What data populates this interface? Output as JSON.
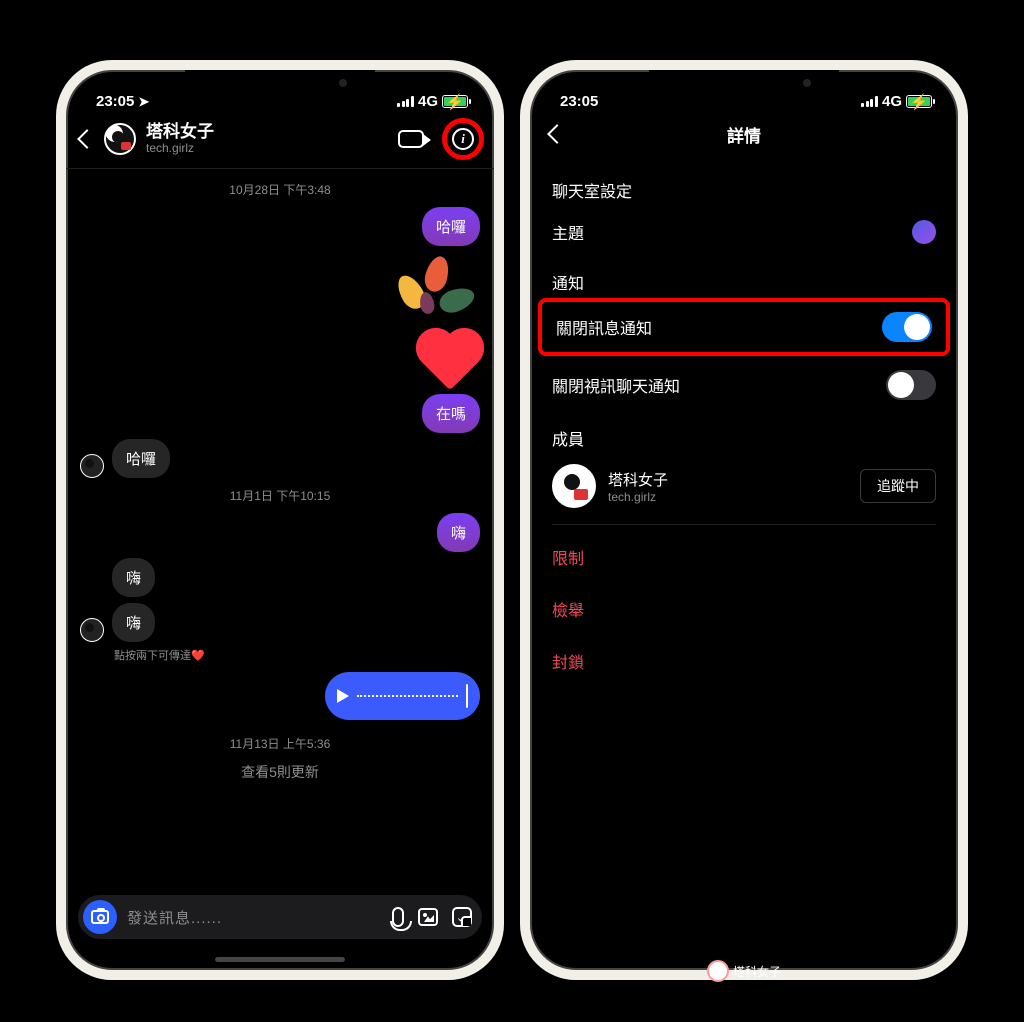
{
  "status": {
    "time": "23:05",
    "network": "4G"
  },
  "left": {
    "header": {
      "title": "塔科女子",
      "username": "tech.girlz"
    },
    "timestamps": {
      "t1": "10月28日 下午3:48",
      "t2": "11月1日 下午10:15",
      "t3": "11月13日 上午5:36"
    },
    "messages": {
      "m1": "哈囉",
      "m2": "在嗎",
      "m3": "哈囉",
      "m4": "嗨",
      "m5": "嗨",
      "m6": "嗨"
    },
    "hint": "點按兩下可傳達❤️",
    "updates": "查看5則更新",
    "input_placeholder": "發送訊息......"
  },
  "right": {
    "title": "詳情",
    "sections": {
      "chat_settings": "聊天室設定",
      "theme": "主題",
      "notifications": "通知",
      "mute_messages": "關閉訊息通知",
      "mute_video": "關閉視訊聊天通知",
      "members": "成員"
    },
    "member": {
      "name": "塔科女子",
      "username": "tech.girlz",
      "follow_status": "追蹤中"
    },
    "actions": {
      "restrict": "限制",
      "report": "檢舉",
      "block": "封鎖"
    }
  },
  "watermark": "塔科女子"
}
